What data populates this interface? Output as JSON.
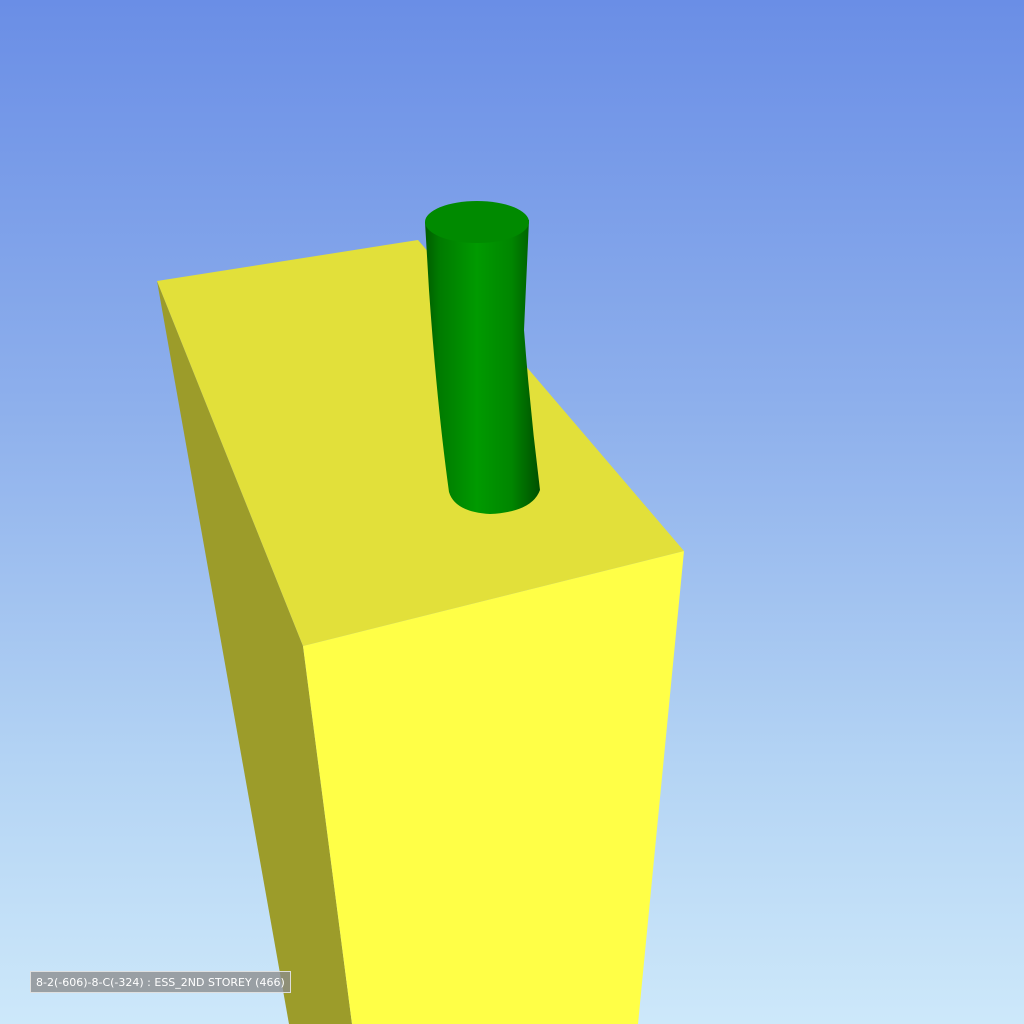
{
  "viewport": {
    "status_label": "8-2(-606)-8-C(-324) : ESS_2ND STOREY (466)"
  },
  "scene": {
    "objects": [
      {
        "name": "yellow-box",
        "kind": "box",
        "colors": {
          "top": "#e2e03a",
          "front": "#ffff47",
          "side": "#9c9c2a"
        }
      },
      {
        "name": "green-cylinder",
        "kind": "cylinder",
        "colors": {
          "body": "#008a00",
          "top": "#008800",
          "shadow": "#005c00"
        }
      }
    ]
  },
  "colors": {
    "sky_top": "#6a8ee6",
    "sky_bottom": "#cde8fa"
  }
}
